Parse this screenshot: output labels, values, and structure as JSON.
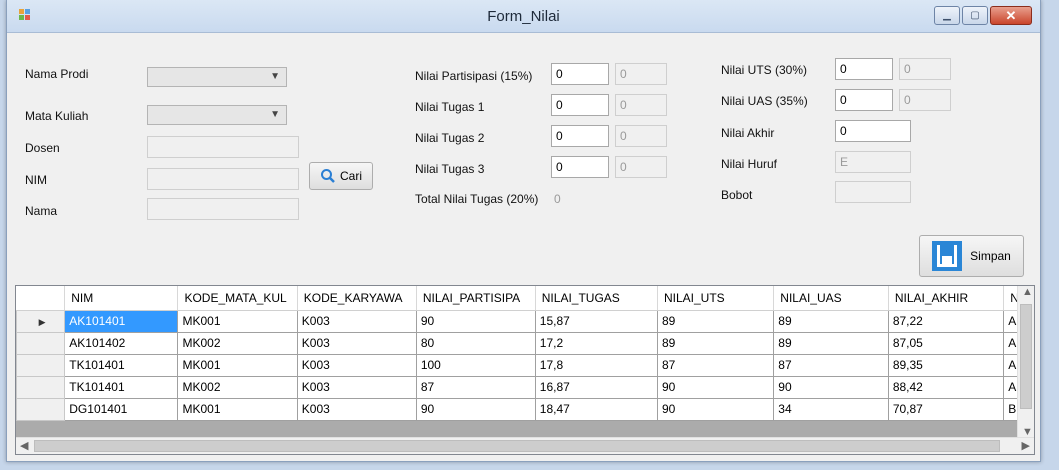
{
  "window": {
    "title": "Form_Nilai"
  },
  "form": {
    "nama_prodi": {
      "label": "Nama Prodi",
      "value": ""
    },
    "mata_kuliah": {
      "label": "Mata Kuliah",
      "value": ""
    },
    "dosen": {
      "label": "Dosen",
      "value": ""
    },
    "nim": {
      "label": "NIM",
      "value": ""
    },
    "nama": {
      "label": "Nama",
      "value": ""
    },
    "cari_button": "Cari",
    "partisipasi": {
      "label": "Nilai Partisipasi (15%)",
      "value": "0",
      "weighted": "0"
    },
    "tugas1": {
      "label": "Nilai Tugas 1",
      "value": "0",
      "weighted": "0"
    },
    "tugas2": {
      "label": "Nilai Tugas 2",
      "value": "0",
      "weighted": "0"
    },
    "tugas3": {
      "label": "Nilai Tugas 3",
      "value": "0",
      "weighted": "0"
    },
    "total_tugas": {
      "label": "Total Nilai Tugas (20%)",
      "value": "0"
    },
    "uts": {
      "label": "Nilai UTS (30%)",
      "value": "0",
      "weighted": "0"
    },
    "uas": {
      "label": "Nilai UAS (35%)",
      "value": "0",
      "weighted": "0"
    },
    "akhir": {
      "label": "Nilai Akhir",
      "value": "0"
    },
    "huruf": {
      "label": "Nilai Huruf",
      "value": "E"
    },
    "bobot": {
      "label": "Bobot",
      "value": ""
    },
    "simpan_button": "Simpan"
  },
  "grid": {
    "columns": [
      "NIM",
      "KODE_MATA_KUL",
      "KODE_KARYAWA",
      "NILAI_PARTISIPA",
      "NILAI_TUGAS",
      "NILAI_UTS",
      "NILAI_UAS",
      "NILAI_AKHIR",
      "NIL"
    ],
    "rows": [
      [
        "AK101401",
        "MK001",
        "K003",
        "90",
        "15,87",
        "89",
        "89",
        "87,22",
        "A"
      ],
      [
        "AK101402",
        "MK002",
        "K003",
        "80",
        "17,2",
        "89",
        "89",
        "87,05",
        "A"
      ],
      [
        "TK101401",
        "MK001",
        "K003",
        "100",
        "17,8",
        "87",
        "87",
        "89,35",
        "A"
      ],
      [
        "TK101401",
        "MK002",
        "K003",
        "87",
        "16,87",
        "90",
        "90",
        "88,42",
        "A"
      ],
      [
        "DG101401",
        "MK001",
        "K003",
        "90",
        "18,47",
        "90",
        "34",
        "70,87",
        "B"
      ]
    ],
    "selected_row": 0,
    "row_indicator": "▶"
  }
}
